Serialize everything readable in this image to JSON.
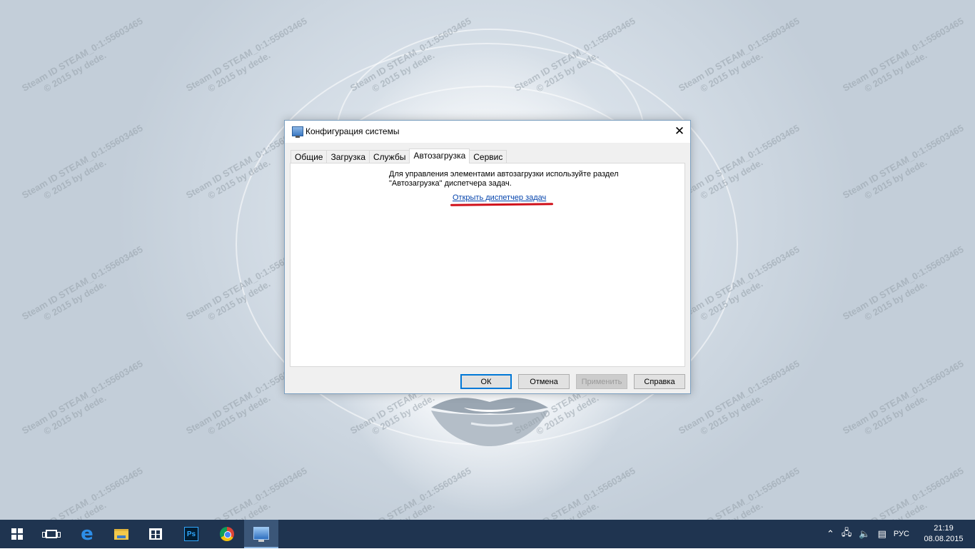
{
  "watermark": {
    "line1": "Steam ID  STEAM_0:1:55603465",
    "line2": "© 2015 by dede."
  },
  "dialog": {
    "title": "Конфигурация системы",
    "tabs": [
      "Общие",
      "Загрузка",
      "Службы",
      "Автозагрузка",
      "Сервис"
    ],
    "active_tab": "Автозагрузка",
    "info_line1": "Для управления элементами автозагрузки используйте раздел",
    "info_line2": "\"Автозагрузка\" диспетчера задач.",
    "link": "Открыть диспетчер задач",
    "buttons": {
      "ok": "ОК",
      "cancel": "Отмена",
      "apply": "Применить",
      "help": "Справка"
    },
    "accent_color": "#0078d7",
    "annotation_color": "#d0101a"
  },
  "taskbar": {
    "pinned_icons": [
      "windows-start-icon",
      "task-view-icon",
      "edge-icon",
      "file-explorer-icon",
      "store-icon",
      "photoshop-icon",
      "chrome-icon",
      "msconfig-icon"
    ],
    "ps_label": "Ps",
    "tray": {
      "language": "РУС",
      "time": "21:19",
      "date": "08.08.2015"
    },
    "background_color": "#1f3450"
  }
}
